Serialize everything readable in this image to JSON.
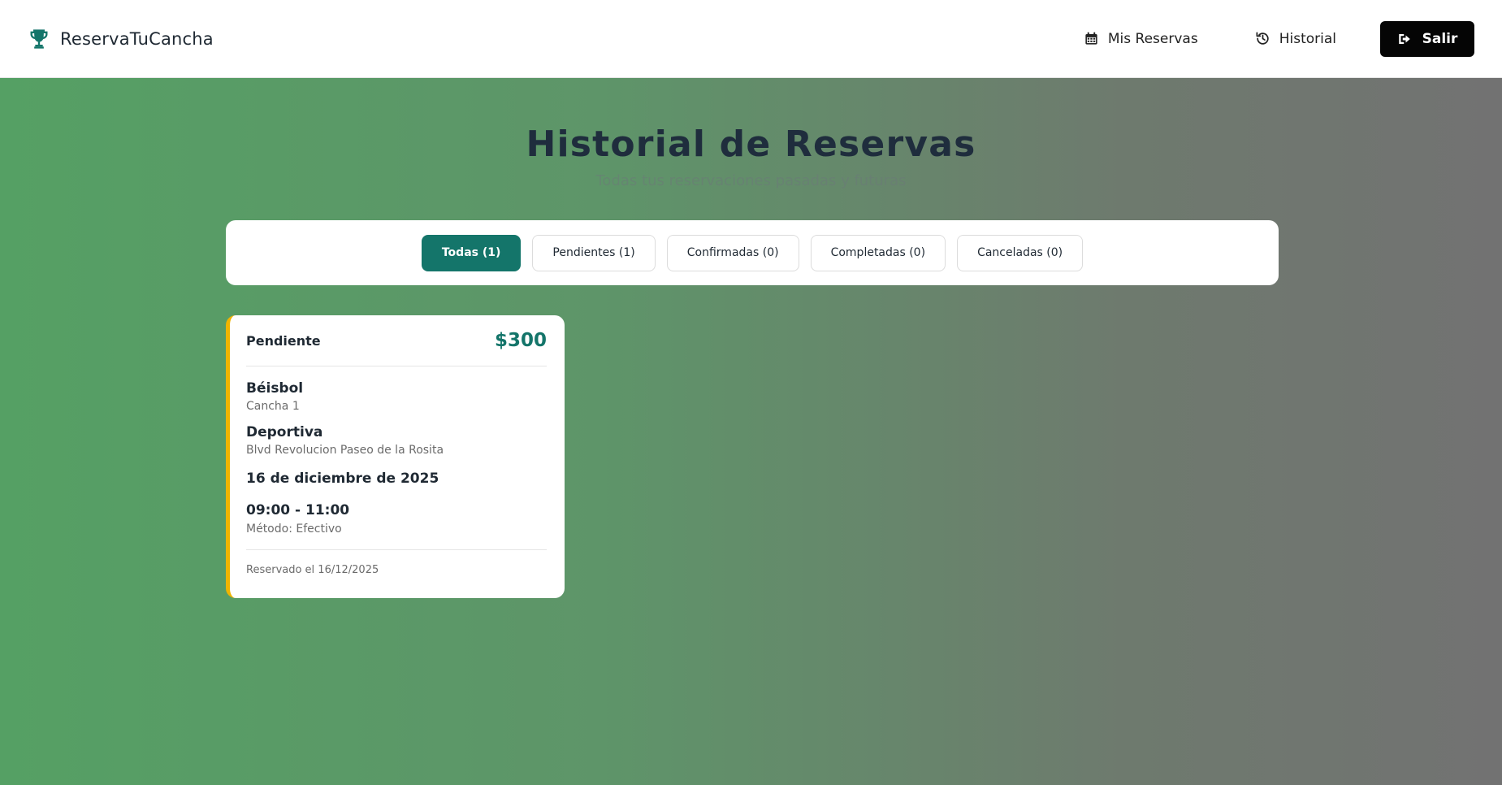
{
  "brand": {
    "name": "ReservaTuCancha",
    "icon": "trophy-icon",
    "accent_color": "#14756a"
  },
  "nav": {
    "mis_reservas": {
      "label": "Mis Reservas",
      "icon": "calendar-icon"
    },
    "historial": {
      "label": "Historial",
      "icon": "history-icon"
    },
    "salir": {
      "label": "Salir",
      "icon": "logout-icon"
    }
  },
  "page": {
    "title": "Historial de Reservas",
    "subtitle": "Todas tus reservaciones pasadas y futuras"
  },
  "filters": [
    {
      "label": "Todas (1)",
      "active": true
    },
    {
      "label": "Pendientes (1)",
      "active": false
    },
    {
      "label": "Confirmadas (0)",
      "active": false
    },
    {
      "label": "Completadas (0)",
      "active": false
    },
    {
      "label": "Canceladas (0)",
      "active": false
    }
  ],
  "reservations": [
    {
      "status": "Pendiente",
      "status_color": "#f0b400",
      "price": "$300",
      "sport": "Béisbol",
      "court": "Cancha 1",
      "venue": "Deportiva",
      "address": "Blvd Revolucion Paseo de la Rosita",
      "date": "16 de diciembre de 2025",
      "time": "09:00 - 11:00",
      "method": "Método: Efectivo",
      "reserved_on": "Reservado el 16/12/2025"
    }
  ]
}
